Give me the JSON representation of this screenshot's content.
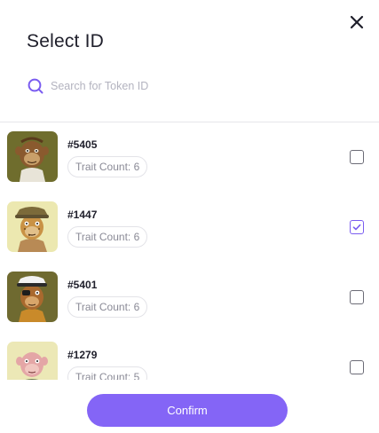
{
  "modal": {
    "title": "Select ID",
    "close_icon": "close-icon"
  },
  "search": {
    "placeholder": "Search for Token ID",
    "value": "",
    "icon": "search-icon"
  },
  "tokens": [
    {
      "id": "#5405",
      "trait": "Trait Count: 6",
      "checked": false,
      "thumb_bg": "#6f6d2d"
    },
    {
      "id": "#1447",
      "trait": "Trait Count: 6",
      "checked": true,
      "thumb_bg": "#ece8b0"
    },
    {
      "id": "#5401",
      "trait": "Trait Count: 6",
      "checked": false,
      "thumb_bg": "#6f6a30"
    },
    {
      "id": "#1279",
      "trait": "Trait Count: 5",
      "checked": false,
      "thumb_bg": "#ece8b6"
    }
  ],
  "confirm_label": "Confirm",
  "colors": {
    "accent": "#8465f6",
    "check": "#7a5cf0"
  }
}
